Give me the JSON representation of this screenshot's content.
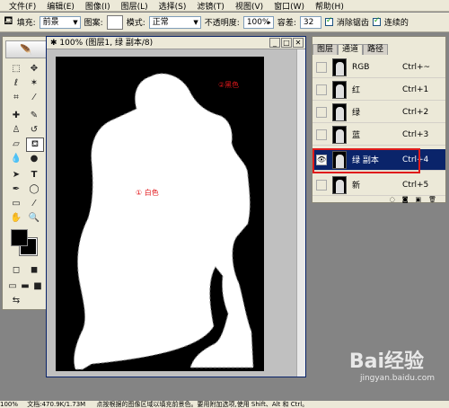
{
  "menu": [
    "文件(F)",
    "编辑(E)",
    "图像(I)",
    "图层(L)",
    "选择(S)",
    "滤镜(T)",
    "视图(V)",
    "窗口(W)",
    "帮助(H)"
  ],
  "options": {
    "fill_label": "填充:",
    "fill_value": "前景",
    "pattern_label": "图案:",
    "mode_label": "模式:",
    "mode_value": "正常",
    "opacity_label": "不透明度:",
    "opacity_value": "100%",
    "tolerance_label": "容差:",
    "tolerance_value": "32",
    "antialias_label": "消除锯齿",
    "contiguous_label": "连续的"
  },
  "document": {
    "title": "100% (图层1, 绿 副本/8)",
    "annotation_black": "②黑色",
    "annotation_white": "① 白色"
  },
  "channels": {
    "tabs": [
      "图层",
      "通道",
      "路径"
    ],
    "rows": [
      {
        "name": "RGB",
        "shortcut": "Ctrl+~"
      },
      {
        "name": "红",
        "shortcut": "Ctrl+1"
      },
      {
        "name": "绿",
        "shortcut": "Ctrl+2"
      },
      {
        "name": "蓝",
        "shortcut": "Ctrl+3"
      },
      {
        "name": "绿 副本",
        "shortcut": "Ctrl+4"
      },
      {
        "name": "新",
        "shortcut": "Ctrl+5"
      }
    ]
  },
  "status": {
    "zoom": "100%",
    "doc": "文档:470.9K/1.73M",
    "hint": "点按根据的图像区域以填充前景色。要用附加选项,使用 Shift、Alt 和 Ctrl。"
  },
  "watermark": {
    "brand": "Bai经验",
    "url": "jingyan.baidu.com"
  },
  "colors": {
    "accent": "#0a246a",
    "highlight": "#e01b1b"
  }
}
